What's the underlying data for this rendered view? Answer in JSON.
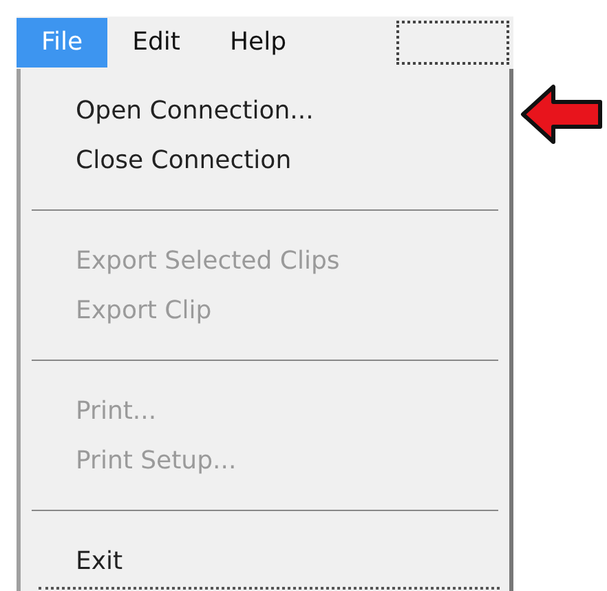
{
  "menu_bar": [
    {
      "label": "File",
      "selected": true
    },
    {
      "label": "Edit",
      "selected": false
    },
    {
      "label": "Help",
      "selected": false
    }
  ],
  "file_menu": [
    {
      "kind": "item",
      "label": "Open Connection...",
      "disabled": false
    },
    {
      "kind": "item",
      "label": "Close Connection",
      "disabled": false
    },
    {
      "kind": "separator"
    },
    {
      "kind": "item",
      "label": "Export Selected Clips",
      "disabled": true
    },
    {
      "kind": "item",
      "label": "Export Clip",
      "disabled": true
    },
    {
      "kind": "separator"
    },
    {
      "kind": "item",
      "label": "Print...",
      "disabled": true
    },
    {
      "kind": "item",
      "label": "Print Setup...",
      "disabled": true
    },
    {
      "kind": "separator"
    },
    {
      "kind": "item",
      "label": "Exit",
      "disabled": false
    }
  ]
}
